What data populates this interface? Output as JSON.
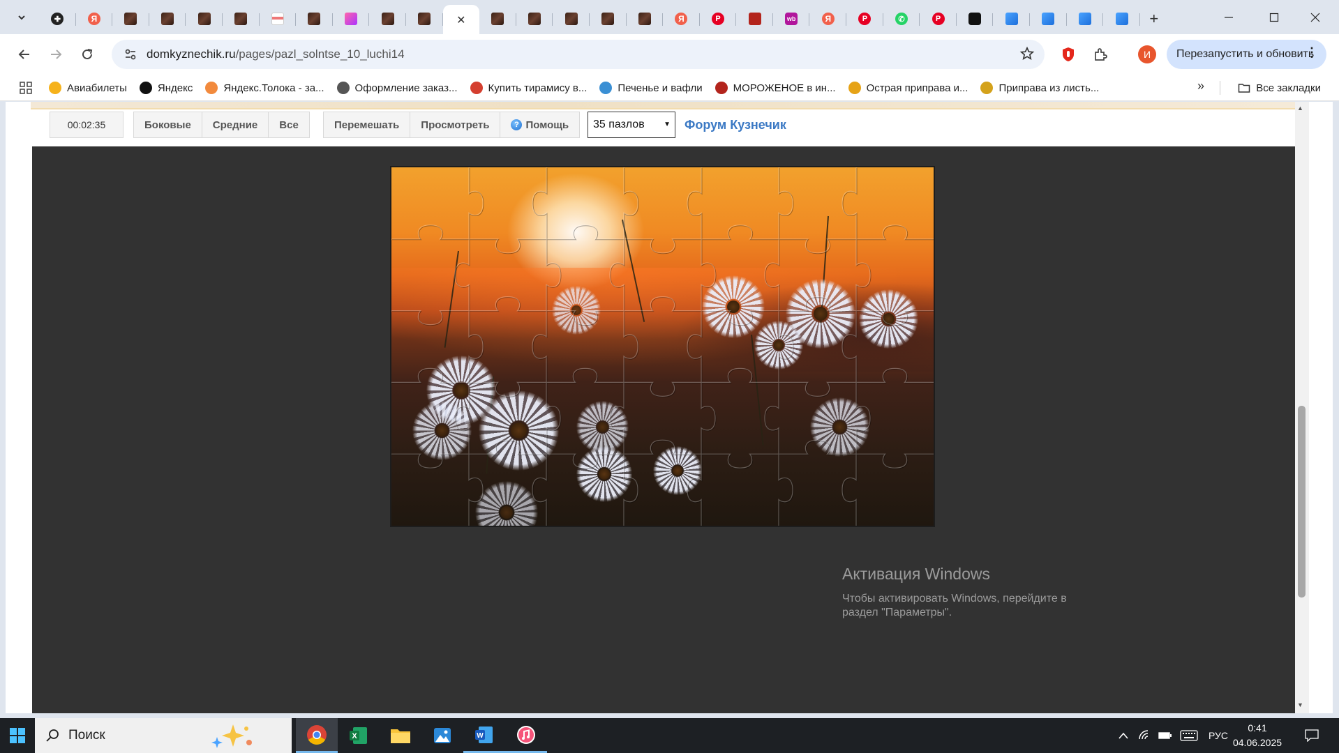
{
  "browser": {
    "active_tab_close": "✕",
    "new_tab": "+",
    "url_host": "domkyznechik.ru",
    "url_path": "/pages/pazl_solntse_10_luchi14",
    "relaunch_label": "Перезапустить и обновить",
    "profile_initial": "И",
    "tab_favicons": [
      "plus",
      "ya",
      "choc",
      "choc",
      "choc",
      "choc",
      "cake",
      "choc",
      "pink",
      "choc",
      "choc",
      "active",
      "choc",
      "choc",
      "choc",
      "choc",
      "choc",
      "ya",
      "pin",
      "red",
      "wb",
      "ya",
      "pin",
      "wa",
      "pin",
      "dark",
      "blue",
      "blue",
      "blue",
      "blue"
    ],
    "tab_fav_text": {
      "ya": "Я",
      "wb": "wb",
      "pin": "P",
      "wa": "✆",
      "plus": "✚"
    }
  },
  "bookmarks": {
    "items": [
      {
        "label": "Авиабилеты",
        "color": "#f6b21b"
      },
      {
        "label": "Яндекс",
        "color": "#111111"
      },
      {
        "label": "Яндекс.Толока - за...",
        "color": "#f28a3d"
      },
      {
        "label": "Оформление заказ...",
        "color": "#555555"
      },
      {
        "label": "Купить тирамису в...",
        "color": "#d43f2f"
      },
      {
        "label": "Печенье и вафли",
        "color": "#3a8fd4"
      },
      {
        "label": "МОРОЖЕНОЕ в ин...",
        "color": "#b3241c"
      },
      {
        "label": "Острая приправа и...",
        "color": "#e6a317"
      },
      {
        "label": "Приправа из листь...",
        "color": "#d4a21b"
      }
    ],
    "more": "»",
    "all_label": "Все закладки"
  },
  "puzzle_page": {
    "timer": "00:02:35",
    "group1": [
      "Боковые",
      "Средние",
      "Все"
    ],
    "group2": [
      "Перемешать",
      "Просмотреть",
      "Помощь"
    ],
    "pieces_select": "35 пазлов",
    "forum_link": "Форум Кузнечик",
    "grid": {
      "cols": 7,
      "rows": 5
    }
  },
  "watermark": {
    "title": "Активация Windows",
    "line": "Чтобы активировать Windows, перейдите в раздел \"Параметры\"."
  },
  "taskbar": {
    "search_label": "Поиск",
    "lang": "РУС",
    "time": "0:41",
    "date": "04.06.2025",
    "apps": [
      "chrome",
      "excel",
      "explorer",
      "photos",
      "word",
      "itunes"
    ]
  },
  "colors": {
    "accent_link": "#3b79c4",
    "board": "#323232",
    "chrome_bg": "#dfe5ee",
    "relaunch_bg": "#d3e3fd"
  }
}
